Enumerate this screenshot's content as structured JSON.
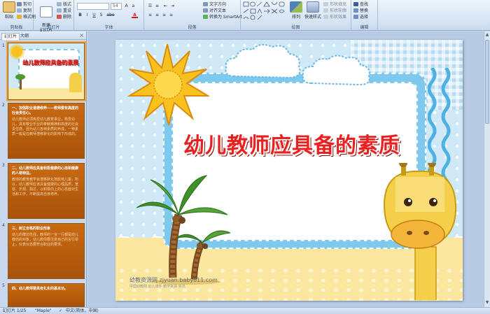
{
  "ribbon": {
    "clipboard": {
      "paste": "粘贴",
      "cut": "剪切",
      "copy": "复制",
      "format_painter": "格式刷",
      "label": "剪贴板"
    },
    "slides": {
      "new_slide": "新建\n幻灯片",
      "layout": "版式",
      "reset": "重设",
      "delete": "删除",
      "label": "幻灯片"
    },
    "font": {
      "name_value": "",
      "size_value": "54",
      "label": "字体",
      "bold": "B",
      "italic": "I",
      "underline": "U",
      "shadow": "S",
      "strike": "abe",
      "color": "A"
    },
    "paragraph": {
      "text_direction": "文字方向",
      "align_text": "对齐文本",
      "smartart": "转换为 SmartArt",
      "label": "段落"
    },
    "drawing": {
      "arrange": "排列",
      "quick_styles": "快速样式",
      "shape_fill": "形状填充",
      "shape_outline": "形状轮廓",
      "shape_effects": "形状效果",
      "label": "绘图"
    },
    "editing": {
      "find": "查找",
      "replace": "替换",
      "select": "选择",
      "label": "编辑"
    }
  },
  "pane": {
    "tabs": [
      "幻灯片",
      "大纲"
    ],
    "close": "×",
    "thumbs": [
      {
        "num": "1",
        "title": "幼儿教师应具备的素质"
      },
      {
        "num": "2",
        "heading": "一、加强职业道德修养——教师要有高度的社会责任心。",
        "body": "幼儿教师必须热爱幼儿教育事业，热爱幼儿，具有敬业乐业的奉献精神和高度的社会责任感。因为幼儿各种素质的养成，一种素质一般是在教师潜移默化的影响下形成的。"
      },
      {
        "num": "3",
        "heading": "二、幼儿教师应具备积极健康的心态和健康的人格特征。",
        "body": "教师的教育教学会潜移默化地影响儿童，所以，幼儿教师应该具备健康的心理品质，宽容、乐观、豁达，以积极向上的心态面对生活和工作，不断提高自身修养。"
      },
      {
        "num": "4",
        "heading": "三、树立合格的职业形象",
        "body": "幼儿的模仿性强，教师的一言一行都是幼儿模仿的对象，幼儿教师要注意自己的言行举止，仪表仪态要符合职业的要求。"
      },
      {
        "num": "5",
        "heading": "四、幼儿教师要具有扎实的基本功。",
        "body": ""
      }
    ]
  },
  "slide": {
    "title": "幼儿教师应具备的素质",
    "watermark": "幼教资源网 zjyuan.baby611.com",
    "watermark_sub": "中国幼教网  幼儿课件  教学资源  资讯"
  },
  "status": {
    "slide_info": "幻灯片 1/25",
    "theme": "\"Maple\"",
    "language": "中文(简体，中国)"
  },
  "colors": {
    "title_red": "#e8201f",
    "frame_blue": "#7fc9ee",
    "sand": "#fbe7a0",
    "sun": "#f7c21f",
    "thumb_orange": "#c96a12"
  }
}
